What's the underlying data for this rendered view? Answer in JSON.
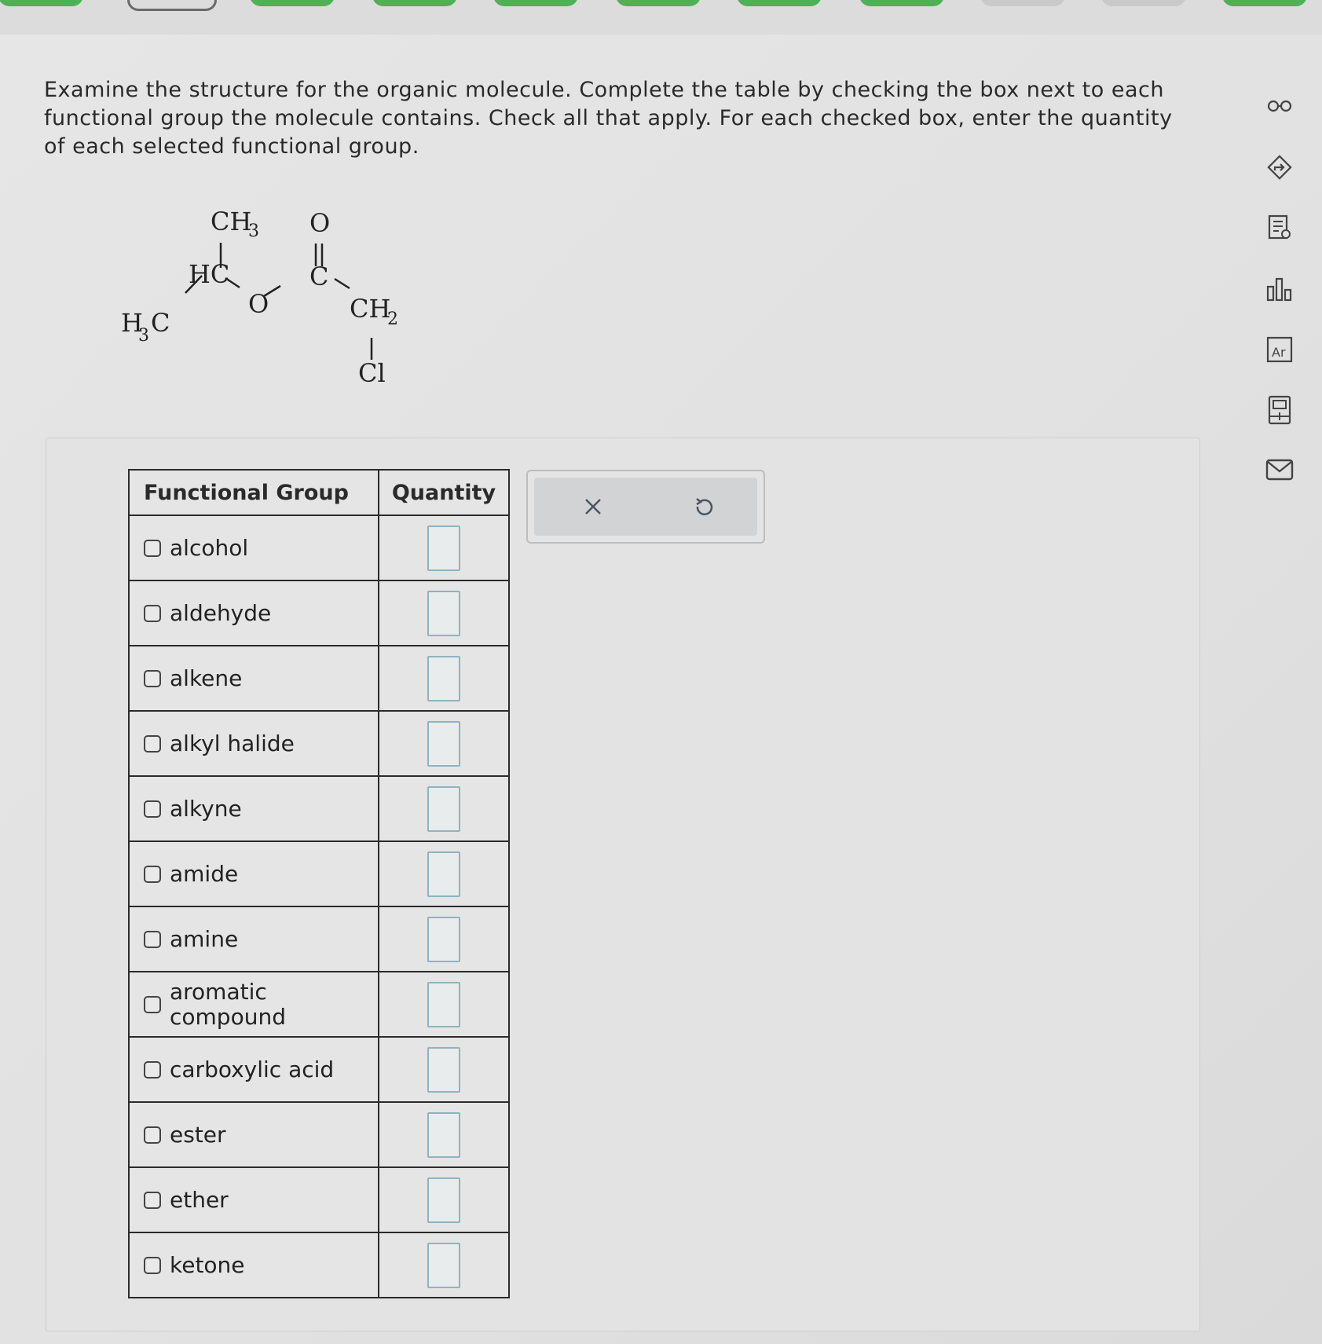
{
  "question": {
    "text": "Examine the structure for the organic molecule. Complete the table by checking the box next to each functional group the molecule contains. Check all that apply. For each checked box, enter the quantity of each selected functional group."
  },
  "molecule": {
    "labels": {
      "ch3_top": "CH",
      "ch3_top_sub": "3",
      "hc": "HC",
      "h3c_h": "H",
      "h3c_sub": "3",
      "h3c_c": "C",
      "o_ether": "O",
      "o_carbonyl": "O",
      "c_carbonyl": "C",
      "ch2": "CH",
      "ch2_sub": "2",
      "cl": "Cl"
    }
  },
  "table": {
    "header_group": "Functional Group",
    "header_quantity": "Quantity",
    "rows": [
      {
        "label": "alcohol",
        "checked": false,
        "quantity": ""
      },
      {
        "label": "aldehyde",
        "checked": false,
        "quantity": ""
      },
      {
        "label": "alkene",
        "checked": false,
        "quantity": ""
      },
      {
        "label": "alkyl halide",
        "checked": false,
        "quantity": ""
      },
      {
        "label": "alkyne",
        "checked": false,
        "quantity": ""
      },
      {
        "label": "amide",
        "checked": false,
        "quantity": ""
      },
      {
        "label": "amine",
        "checked": false,
        "quantity": ""
      },
      {
        "label": "aromatic compound",
        "checked": false,
        "quantity": ""
      },
      {
        "label": "carboxylic acid",
        "checked": false,
        "quantity": ""
      },
      {
        "label": "ester",
        "checked": false,
        "quantity": ""
      },
      {
        "label": "ether",
        "checked": false,
        "quantity": ""
      },
      {
        "label": "ketone",
        "checked": false,
        "quantity": ""
      }
    ]
  },
  "controls": {
    "clear_icon": "x-icon",
    "undo_icon": "undo-icon"
  },
  "sidebar": {
    "icons": [
      "glasses-icon",
      "hint-arrow-icon",
      "notes-icon",
      "chart-icon",
      "periodic-table-icon",
      "calculator-icon",
      "mail-icon"
    ]
  },
  "colors": {
    "progress_done": "#4fb055",
    "input_border": "#8fb3c0"
  }
}
